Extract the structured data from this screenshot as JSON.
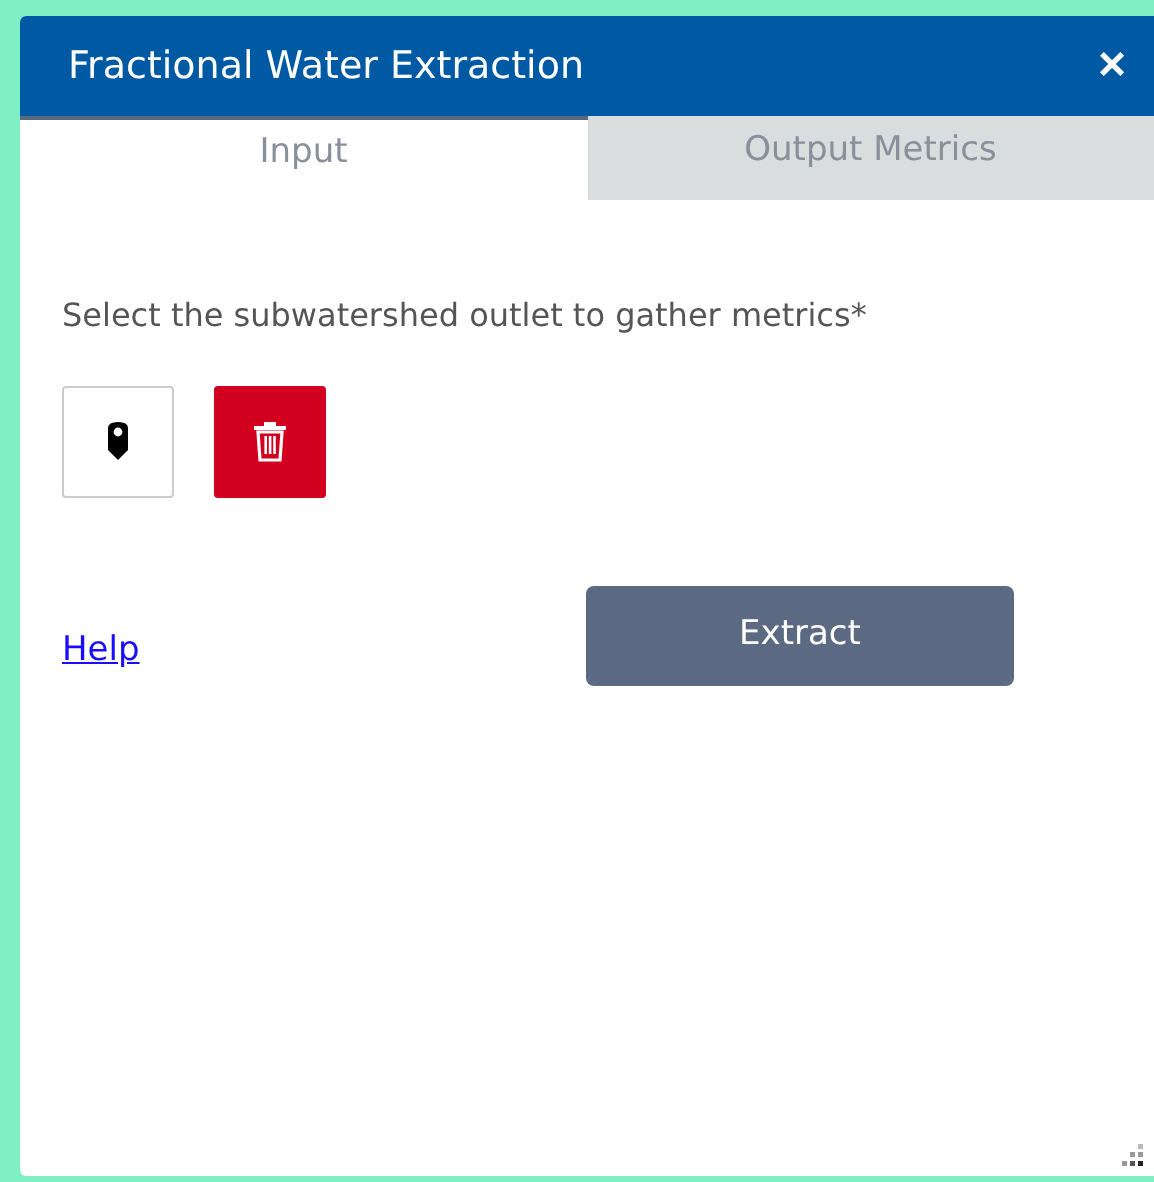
{
  "window": {
    "title": "Fractional Water Extraction",
    "close": "×"
  },
  "tabs": [
    {
      "label": "Input",
      "selected": true
    },
    {
      "label": "Output Metrics",
      "selected": false
    }
  ],
  "instruction": "Select the subwatershed outlet to gather metrics*",
  "help_link": "Help",
  "extract_button": "Extract"
}
